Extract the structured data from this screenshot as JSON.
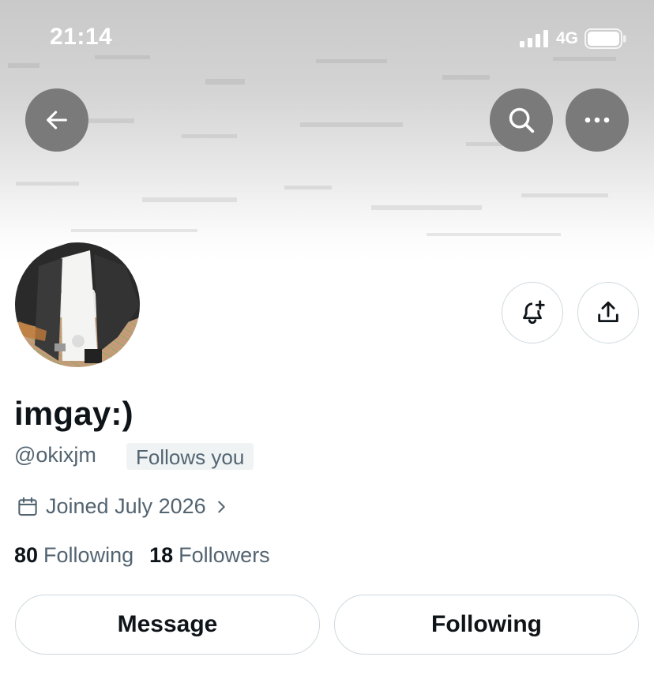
{
  "status_bar": {
    "time": "21:14",
    "network": "4G",
    "icons": [
      "signal-icon",
      "battery-icon"
    ]
  },
  "header": {
    "back_icon": "arrow-left-icon",
    "search_icon": "search-icon",
    "more_icon": "more-horizontal-icon"
  },
  "profile": {
    "display_name": "imgay:)",
    "handle": "@okixjm",
    "follows_you_label": "Follows you",
    "joined": "Joined July 2026",
    "following_count": "80",
    "following_label": "Following",
    "followers_count": "18",
    "followers_label": "Followers"
  },
  "actions": {
    "notify_icon": "bell-plus-icon",
    "share_icon": "share-upload-icon",
    "message_label": "Message",
    "following_button_label": "Following"
  },
  "colors": {
    "text_primary": "#0f1419",
    "text_secondary": "#536471",
    "border": "#cfd9de",
    "badge_bg": "#eff3f4",
    "header_button_bg": "#7a7a7a"
  }
}
